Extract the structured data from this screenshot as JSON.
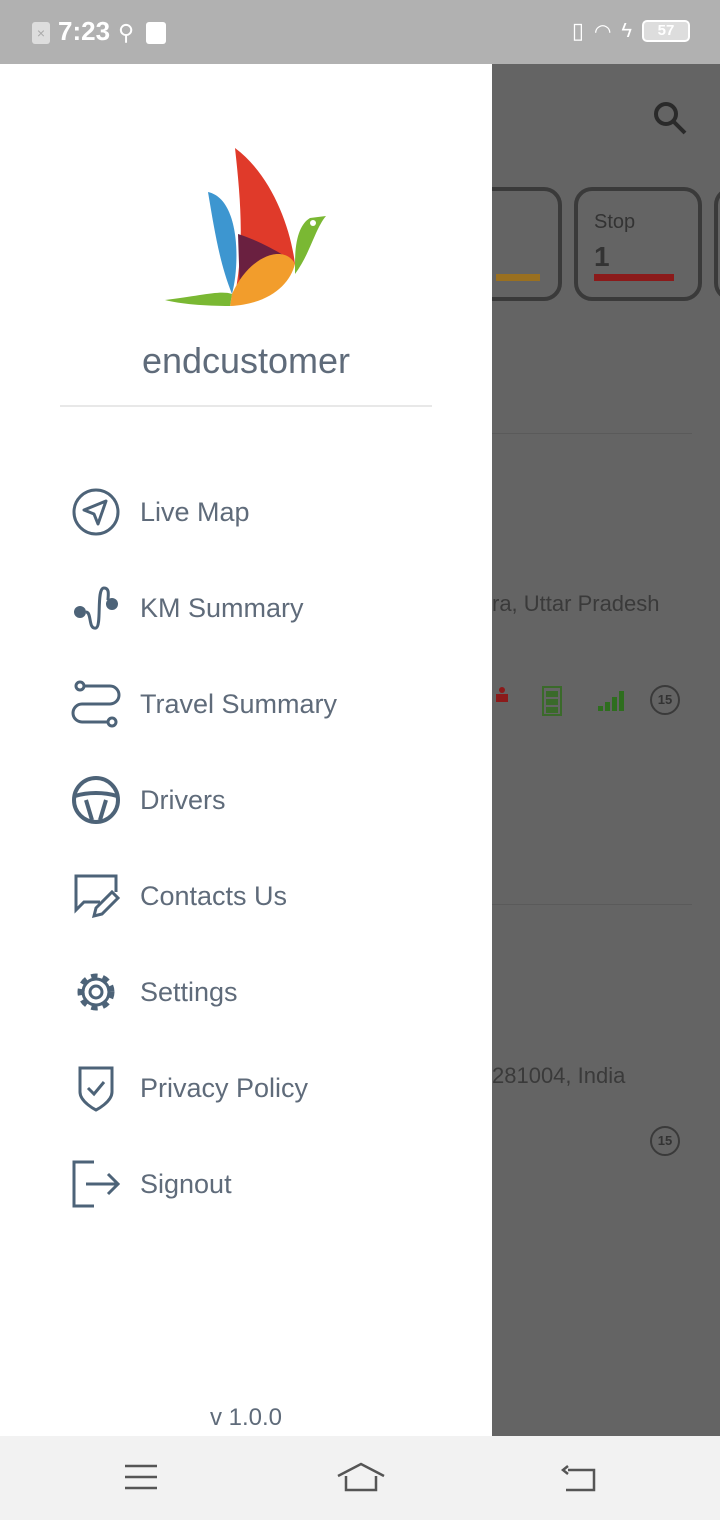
{
  "status_bar": {
    "time": "7:23",
    "battery": "57"
  },
  "drawer": {
    "username": "endcustomer",
    "menu": [
      {
        "label": "Live Map",
        "icon": "navigation-arrow-icon"
      },
      {
        "label": "KM Summary",
        "icon": "route-ab-icon"
      },
      {
        "label": "Travel Summary",
        "icon": "path-icon"
      },
      {
        "label": "Drivers",
        "icon": "steering-wheel-icon"
      },
      {
        "label": "Contacts Us",
        "icon": "chat-edit-icon"
      },
      {
        "label": "Settings",
        "icon": "gear-icon"
      },
      {
        "label": "Privacy Policy",
        "icon": "shield-check-icon"
      },
      {
        "label": "Signout",
        "icon": "signout-icon"
      }
    ],
    "version": "v 1.0.0"
  },
  "background": {
    "stop_card": {
      "label": "Stop",
      "value": "1"
    },
    "addresses": [
      "ra, Uttar Pradesh",
      "281004, India"
    ],
    "satellite_count": "15"
  },
  "colors": {
    "menu_text": "#5f6b7a",
    "stop_bar": "#8b1a1a",
    "idle_bar": "#9a7020"
  }
}
